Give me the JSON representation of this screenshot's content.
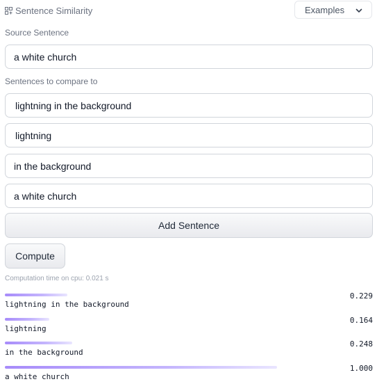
{
  "header": {
    "task_label": "Sentence Similarity",
    "task_icon": "sentence-similarity-icon",
    "examples_label": "Examples"
  },
  "source": {
    "label": "Source Sentence",
    "value": "a white church"
  },
  "compare": {
    "label": "Sentences to compare to",
    "sentences": [
      "lightning in the background",
      "lightning",
      "in the background",
      "a white church"
    ]
  },
  "actions": {
    "add_label": "Add Sentence",
    "compute_label": "Compute"
  },
  "computation_time": "Computation time on cpu: 0.021 s",
  "results": [
    {
      "label": "lightning in the background",
      "score": "0.229",
      "fraction": 0.229
    },
    {
      "label": "lightning",
      "score": "0.164",
      "fraction": 0.164
    },
    {
      "label": "in the background",
      "score": "0.248",
      "fraction": 0.248
    },
    {
      "label": "a white church",
      "score": "1.000",
      "fraction": 1.0
    }
  ],
  "colors": {
    "bar_start": "#a78bfa",
    "bar_end": "#e9e5ff"
  }
}
